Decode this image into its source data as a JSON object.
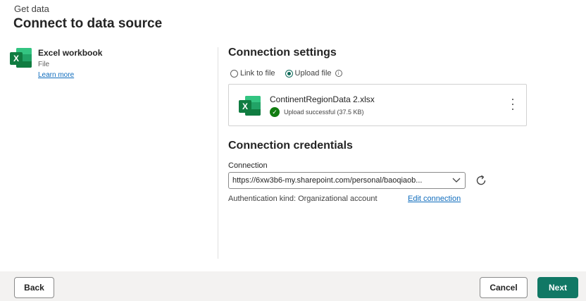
{
  "header": {
    "eyebrow": "Get data",
    "title": "Connect to data source"
  },
  "source": {
    "icon": "excel-icon",
    "name": "Excel workbook",
    "type": "File",
    "learn_more": "Learn more"
  },
  "connection_settings": {
    "title": "Connection settings",
    "radio_options": [
      {
        "label": "Link to file",
        "selected": false
      },
      {
        "label": "Upload file",
        "selected": true
      }
    ],
    "file": {
      "name": "ContinentRegionData 2.xlsx",
      "status": "Upload successful (37.5 KB)"
    }
  },
  "connection_credentials": {
    "title": "Connection credentials",
    "connection_label": "Connection",
    "connection_value": "https://6xw3b6-my.sharepoint.com/personal/baoqiaob...",
    "auth_kind": "Authentication kind: Organizational account",
    "edit_link": "Edit connection"
  },
  "footer": {
    "back": "Back",
    "cancel": "Cancel",
    "next": "Next"
  },
  "colors": {
    "primary": "#117865",
    "link": "#0f6cbd",
    "success": "#107c10",
    "excel_green": "#107c41"
  }
}
